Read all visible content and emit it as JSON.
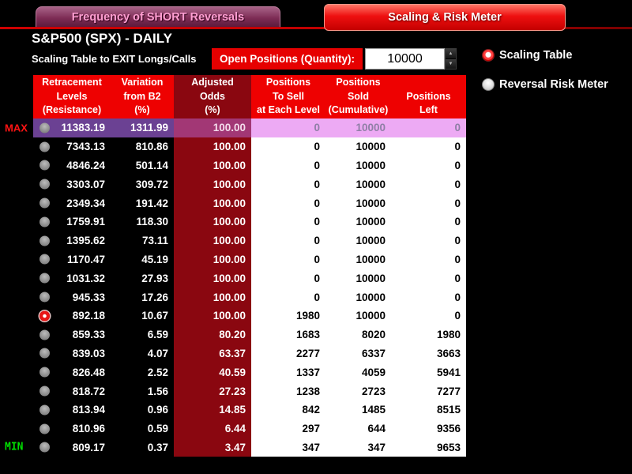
{
  "tabs": [
    {
      "label": "Frequency of SHORT Reversals",
      "active": false
    },
    {
      "label": "Scaling & Risk Meter",
      "active": true
    }
  ],
  "header": {
    "title": "S&P500 (SPX) - DAILY",
    "subtitle": "Scaling Table to EXIT Longs/Calls"
  },
  "controls": {
    "open_positions_label": "Open Positions (Quantity):",
    "open_positions_value": "10000",
    "spinner_up_icon": "▲",
    "spinner_down_icon": "▼"
  },
  "view_options": [
    {
      "label": "Scaling Table",
      "selected": true
    },
    {
      "label": "Reversal Risk Meter",
      "selected": false
    }
  ],
  "table": {
    "columns": [
      {
        "id": "retracement-levels",
        "lines": [
          "Retracement",
          "Levels",
          "(Resistance)"
        ]
      },
      {
        "id": "variation-from-b2",
        "lines": [
          "Variation",
          "from B2",
          "(%)"
        ]
      },
      {
        "id": "adjusted-odds",
        "lines": [
          "Adjusted",
          "Odds",
          "(%)"
        ]
      },
      {
        "id": "positions-to-sell",
        "lines": [
          "Positions",
          "To Sell",
          "at Each Level"
        ]
      },
      {
        "id": "positions-sold",
        "lines": [
          "Positions",
          "Sold",
          "(Cumulative)"
        ]
      },
      {
        "id": "positions-left",
        "lines": [
          "",
          "Positions",
          "Left"
        ]
      }
    ],
    "rows": [
      {
        "level": "11383.19",
        "variation": "1311.99",
        "odds": "100.00",
        "to_sell": "0",
        "sold": "10000",
        "left": "0",
        "tag": "MAX",
        "highlight": true,
        "selected": false
      },
      {
        "level": "7343.13",
        "variation": "810.86",
        "odds": "100.00",
        "to_sell": "0",
        "sold": "10000",
        "left": "0",
        "highlight": false,
        "selected": false
      },
      {
        "level": "4846.24",
        "variation": "501.14",
        "odds": "100.00",
        "to_sell": "0",
        "sold": "10000",
        "left": "0",
        "highlight": false,
        "selected": false
      },
      {
        "level": "3303.07",
        "variation": "309.72",
        "odds": "100.00",
        "to_sell": "0",
        "sold": "10000",
        "left": "0",
        "highlight": false,
        "selected": false
      },
      {
        "level": "2349.34",
        "variation": "191.42",
        "odds": "100.00",
        "to_sell": "0",
        "sold": "10000",
        "left": "0",
        "highlight": false,
        "selected": false
      },
      {
        "level": "1759.91",
        "variation": "118.30",
        "odds": "100.00",
        "to_sell": "0",
        "sold": "10000",
        "left": "0",
        "highlight": false,
        "selected": false
      },
      {
        "level": "1395.62",
        "variation": "73.11",
        "odds": "100.00",
        "to_sell": "0",
        "sold": "10000",
        "left": "0",
        "highlight": false,
        "selected": false
      },
      {
        "level": "1170.47",
        "variation": "45.19",
        "odds": "100.00",
        "to_sell": "0",
        "sold": "10000",
        "left": "0",
        "highlight": false,
        "selected": false
      },
      {
        "level": "1031.32",
        "variation": "27.93",
        "odds": "100.00",
        "to_sell": "0",
        "sold": "10000",
        "left": "0",
        "highlight": false,
        "selected": false
      },
      {
        "level": "945.33",
        "variation": "17.26",
        "odds": "100.00",
        "to_sell": "0",
        "sold": "10000",
        "left": "0",
        "highlight": false,
        "selected": false
      },
      {
        "level": "892.18",
        "variation": "10.67",
        "odds": "100.00",
        "to_sell": "1980",
        "sold": "10000",
        "left": "0",
        "highlight": false,
        "selected": true
      },
      {
        "level": "859.33",
        "variation": "6.59",
        "odds": "80.20",
        "to_sell": "1683",
        "sold": "8020",
        "left": "1980",
        "highlight": false,
        "selected": false
      },
      {
        "level": "839.03",
        "variation": "4.07",
        "odds": "63.37",
        "to_sell": "2277",
        "sold": "6337",
        "left": "3663",
        "highlight": false,
        "selected": false
      },
      {
        "level": "826.48",
        "variation": "2.52",
        "odds": "40.59",
        "to_sell": "1337",
        "sold": "4059",
        "left": "5941",
        "highlight": false,
        "selected": false
      },
      {
        "level": "818.72",
        "variation": "1.56",
        "odds": "27.23",
        "to_sell": "1238",
        "sold": "2723",
        "left": "7277",
        "highlight": false,
        "selected": false
      },
      {
        "level": "813.94",
        "variation": "0.96",
        "odds": "14.85",
        "to_sell": "842",
        "sold": "1485",
        "left": "8515",
        "highlight": false,
        "selected": false
      },
      {
        "level": "810.96",
        "variation": "0.59",
        "odds": "6.44",
        "to_sell": "297",
        "sold": "644",
        "left": "9356",
        "highlight": false,
        "selected": false
      },
      {
        "level": "809.17",
        "variation": "0.37",
        "odds": "3.47",
        "to_sell": "347",
        "sold": "347",
        "left": "9653",
        "tag": "MIN",
        "highlight": false,
        "selected": false
      }
    ]
  },
  "colors": {
    "header_red": "#ee0101",
    "odds_maroon": "#8a0710",
    "highlight_purple": "#6b4193",
    "highlight_pink": "#edaaf4",
    "max_label": "#ff1414",
    "min_label": "#00dd00",
    "active_tab_red": "#ee1010",
    "inactive_tab_plum": "#7c2b54"
  }
}
